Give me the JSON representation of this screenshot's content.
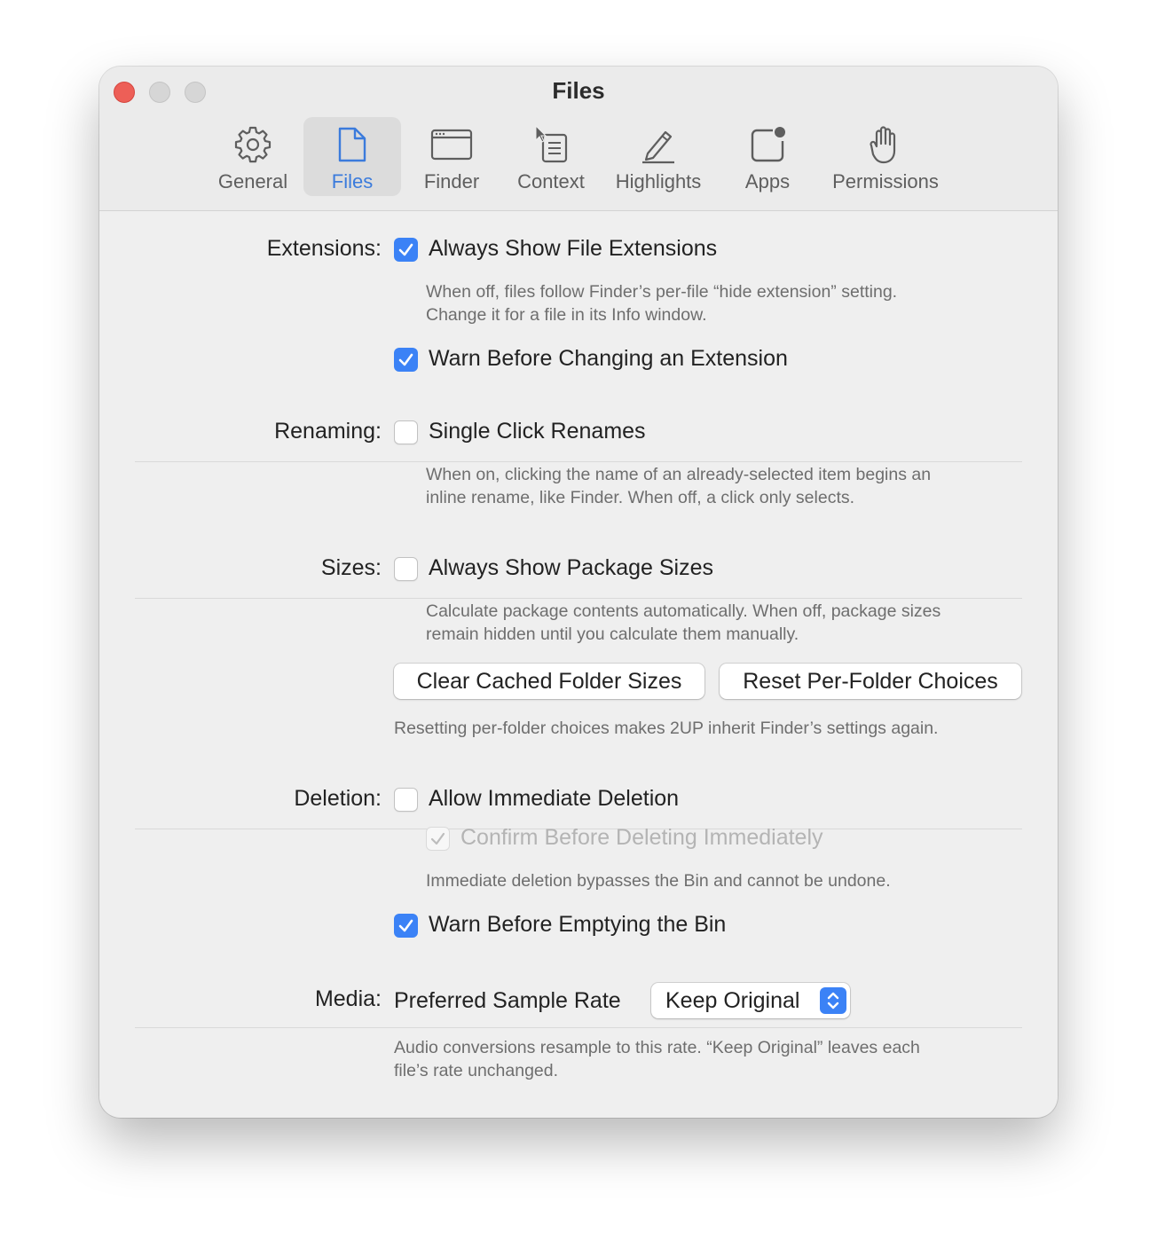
{
  "window": {
    "title": "Files"
  },
  "toolbar": {
    "tabs": [
      {
        "label": "General",
        "icon": "gear-icon"
      },
      {
        "label": "Files",
        "icon": "document-icon",
        "active": true
      },
      {
        "label": "Finder",
        "icon": "window-icon"
      },
      {
        "label": "Context",
        "icon": "context-menu-icon"
      },
      {
        "label": "Highlights",
        "icon": "pencil-icon"
      },
      {
        "label": "Apps",
        "icon": "app-badge-icon"
      },
      {
        "label": "Permissions",
        "icon": "hand-icon"
      }
    ]
  },
  "extensions": {
    "label": "Extensions:",
    "always_show": {
      "label": "Always Show File Extensions",
      "checked": true
    },
    "description_line1": "When off, files follow Finder’s per-file “hide extension” setting.",
    "description_line2": "Change it for a file in its Info window.",
    "warn_change": {
      "label": "Warn Before Changing an Extension",
      "checked": true
    }
  },
  "renaming": {
    "label": "Renaming:",
    "single_click": {
      "label": "Single Click Renames",
      "checked": false
    },
    "description_line1": "When on, clicking the name of an already-selected item begins an",
    "description_line2": "inline rename, like Finder. When off, a click only selects."
  },
  "sizes": {
    "label": "Sizes:",
    "package_sizes": {
      "label": "Always Show Package Sizes",
      "checked": false
    },
    "description_line1": "Calculate package contents automatically. When off, package sizes",
    "description_line2": "remain hidden until you calculate them manually.",
    "clear_button": "Clear Cached Folder Sizes",
    "reset_button": "Reset Per-Folder Choices",
    "reset_note": "Resetting per-folder choices makes 2UP inherit Finder’s settings again."
  },
  "deletion": {
    "label": "Deletion:",
    "immediate": {
      "label": "Allow Immediate Deletion",
      "checked": false
    },
    "confirm": {
      "label": "Confirm Before Deleting Immediately",
      "checked": true,
      "disabled": true
    },
    "description": "Immediate deletion bypasses the Bin and cannot be undone.",
    "warn_empty": {
      "label": "Warn Before Emptying the Bin",
      "checked": true
    }
  },
  "media": {
    "label": "Media:",
    "sample_rate_label": "Preferred Sample Rate",
    "sample_rate_value": "Keep Original",
    "description_line1": "Audio conversions resample to this rate. “Keep Original” leaves each",
    "description_line2": "file’s rate unchanged."
  },
  "colors": {
    "accent": "#3b82f6",
    "close": "#ed5f57",
    "window_bg": "#efefef"
  }
}
